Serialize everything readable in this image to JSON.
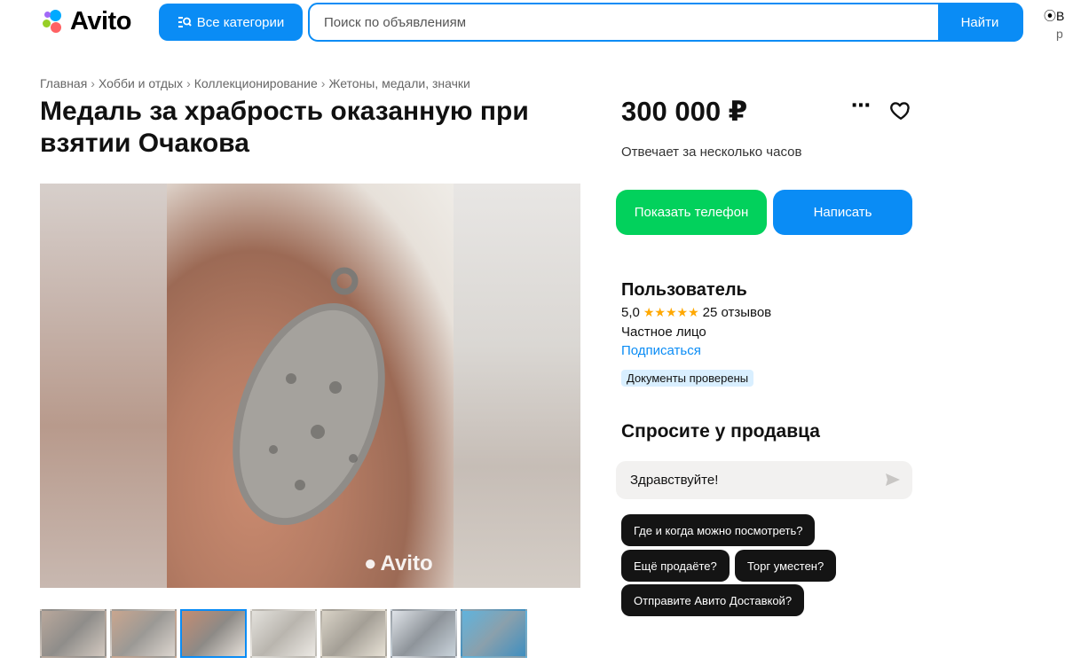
{
  "header": {
    "logo_text": "Avito",
    "categories_label": "Все категории",
    "search_placeholder": "Поиск по объявлениям",
    "search_button": "Найти",
    "location_line1": "В",
    "location_line2": "р"
  },
  "breadcrumb": [
    "Главная",
    "Хобби и отдых",
    "Коллекционирование",
    "Жетоны, медали, значки"
  ],
  "listing": {
    "title": "Медаль за храбрость оказанную при взятии Очакова",
    "price": "300 000 ₽",
    "response_time": "Отвечает за несколько часов",
    "watermark": "Avito",
    "thumbnail_count": 7,
    "active_thumbnail": 3
  },
  "actions": {
    "show_phone": "Показать телефон",
    "write": "Написать"
  },
  "seller": {
    "name": "Пользователь",
    "rating": "5,0",
    "stars": "★★★★★",
    "reviews": "25 отзывов",
    "type": "Частное лицо",
    "subscribe": "Подписаться",
    "badge": "Документы проверены"
  },
  "ask": {
    "title": "Спросите у продавца",
    "message": "Здравствуйте!",
    "chips": [
      "Где и когда можно посмотреть?",
      "Ещё продаёте?",
      "Торг уместен?",
      "Отправите Авито Доставкой?"
    ]
  },
  "colors": {
    "accent": "#0a8cf5",
    "phone_green": "#02d15c",
    "star": "#ffa800"
  }
}
